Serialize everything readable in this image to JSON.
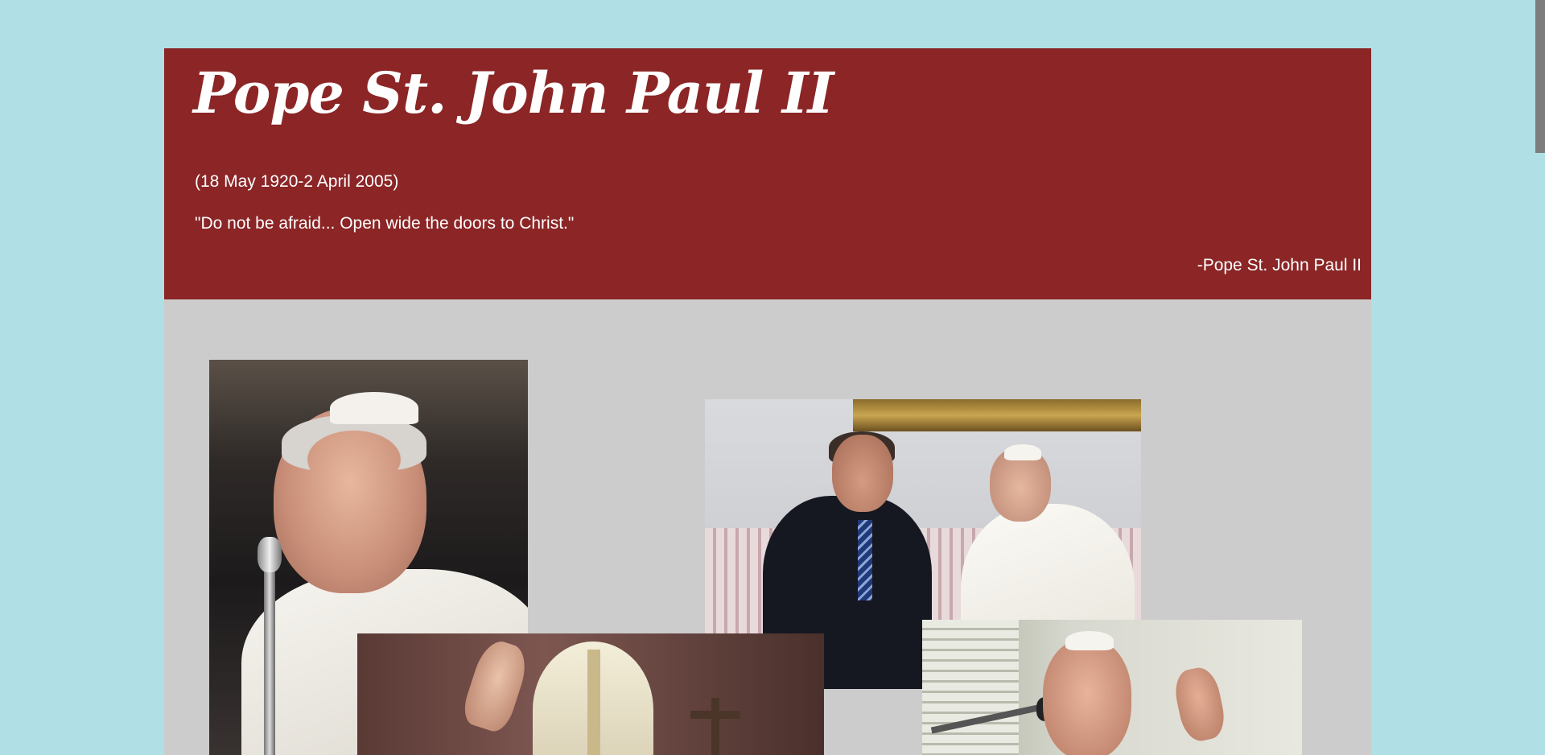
{
  "header": {
    "title": "Pope St. John Paul II",
    "dates": "(18 May 1920-2 April 2005)",
    "quote": "\"Do not be afraid... Open wide the doors to Christ.\"",
    "attribution": "-Pope St. John Paul II"
  },
  "colors": {
    "page_background": "#b0dfe5",
    "header_background": "#8b2526",
    "gallery_background": "#cccccc",
    "header_text": "#ffffff"
  },
  "gallery": {
    "photos": [
      {
        "subject": "portrait-with-microphone"
      },
      {
        "subject": "meeting-with-president"
      },
      {
        "subject": "mitre-blessing"
      },
      {
        "subject": "waving-from-window"
      }
    ]
  }
}
